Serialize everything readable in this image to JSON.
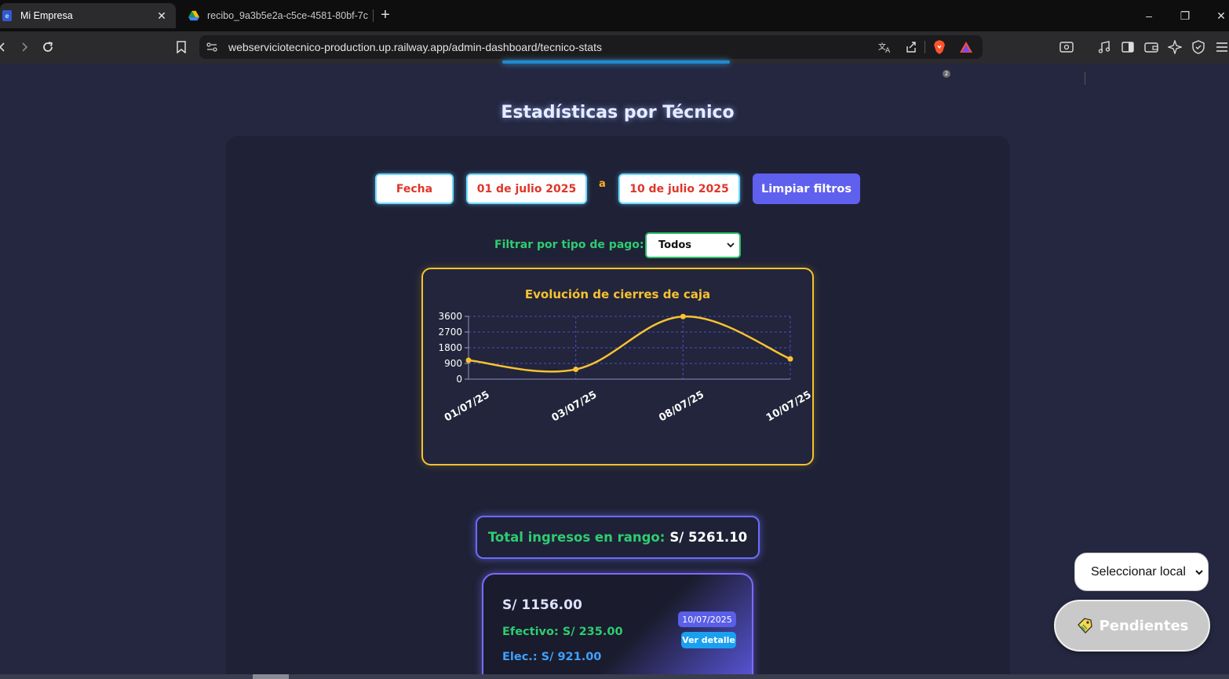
{
  "browser": {
    "tabs": [
      {
        "title": "Mi Empresa",
        "active": true
      },
      {
        "title": "recibo_9a3b5e2a-c5ce-4581-80bf-7c",
        "active": false
      }
    ],
    "new_tab": "+",
    "url": "webserviciotecnico-production.up.railway.app/admin-dashboard/tecnico-stats",
    "window_controls": {
      "minimize": "–",
      "restore": "❐",
      "close": "✕"
    },
    "shield_badge_count": "2"
  },
  "page": {
    "title": "Estadísticas por Técnico",
    "filters": {
      "date_label": "Fecha",
      "start_date": "01 de julio 2025",
      "range_separator": "a",
      "end_date": "10 de julio 2025",
      "clear_button": "Limpiar filtros",
      "payment_label": "Filtrar por tipo de pago:",
      "payment_selected": "Todos"
    },
    "total": {
      "label": "Total ingresos en rango:",
      "value": "S/ 5261.10"
    },
    "receipt": {
      "amount": "S/ 1156.00",
      "cash": "Efectivo: S/ 235.00",
      "electronic": "Elec.: S/ 921.00",
      "date": "10/07/2025",
      "detail_button": "Ver detalle"
    },
    "local_select": "Seleccionar local",
    "pending_button": "Pendientes"
  },
  "colors": {
    "accent_yellow": "#f7c231",
    "accent_green": "#2ecc71",
    "accent_purple": "#6060ee",
    "accent_blue": "#3ea1ff",
    "date_red": "#e0352b"
  },
  "chart_data": {
    "type": "line",
    "title": "Evolución de cierres de caja",
    "categories": [
      "01/07/25",
      "03/07/25",
      "08/07/25",
      "10/07/25"
    ],
    "series": [
      {
        "values": [
          1080,
          560,
          3590,
          1160
        ]
      }
    ],
    "ylim": [
      0,
      3600
    ],
    "yticks": [
      0,
      900,
      1800,
      2700,
      3600
    ],
    "grid": true,
    "line_color": "#f7c231",
    "grid_color": "#4b4fc8"
  }
}
